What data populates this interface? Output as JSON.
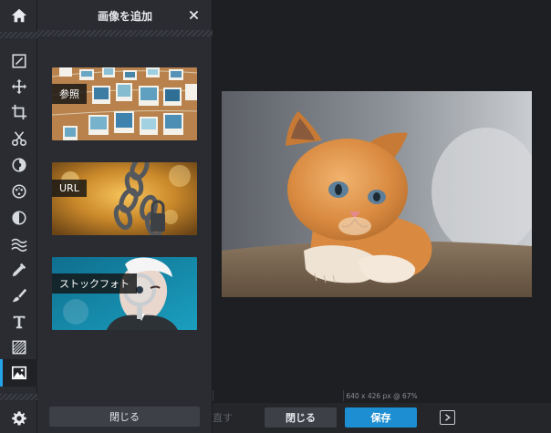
{
  "panel": {
    "title": "画像を追加",
    "close_label": "閉じる",
    "cards": [
      {
        "label": "参照"
      },
      {
        "label": "URL"
      },
      {
        "label": "ストックフォト"
      }
    ]
  },
  "status": {
    "text": "640 x 426 px @ 67%"
  },
  "bottombar": {
    "ghost_text": "直す",
    "close_label": "閉じる",
    "save_label": "保存"
  },
  "colors": {
    "accent": "#25a3e8",
    "save": "#1d8ed1",
    "bg": "#1e1f22",
    "panel": "#2a2c31"
  },
  "toolbar": {
    "icons": [
      "home-icon",
      "edit-icon",
      "move-icon",
      "crop-icon",
      "scissors-icon",
      "adjust-icon",
      "effects-icon",
      "contrast-icon",
      "waves-icon",
      "dropper-icon",
      "brush-icon",
      "text-icon",
      "pattern-icon",
      "image-icon",
      "settings-icon"
    ]
  }
}
